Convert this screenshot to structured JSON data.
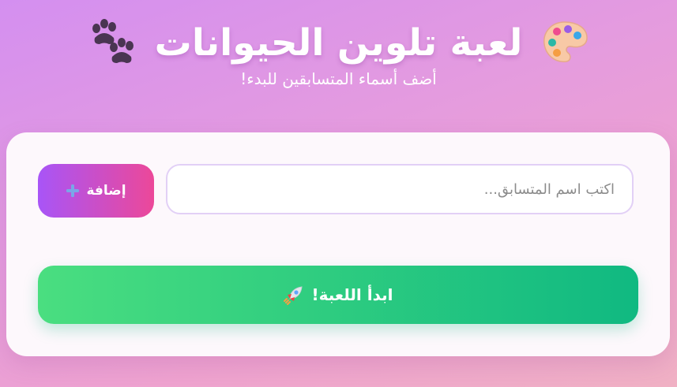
{
  "header": {
    "title": "لعبة تلوين الحيوانات",
    "subtitle": "أضف أسماء المتسابقين للبدء!",
    "left_icon": "paw-prints-icon",
    "right_icon": "artist-palette-icon"
  },
  "form": {
    "name_placeholder": "اكتب اسم المتسابق...",
    "name_value": "",
    "add_label": "إضافة",
    "add_icon": "plus-icon"
  },
  "actions": {
    "start_label": "ابدأ اللعبة!",
    "start_icon": "rocket-icon"
  },
  "colors": {
    "background_gradient": [
      "#d48ff0",
      "#f0b1c4"
    ],
    "add_button_gradient": [
      "#a855f7",
      "#ec4899"
    ],
    "start_button_gradient": [
      "#4ade80",
      "#10b981"
    ],
    "input_border": "#e2d0f6"
  }
}
